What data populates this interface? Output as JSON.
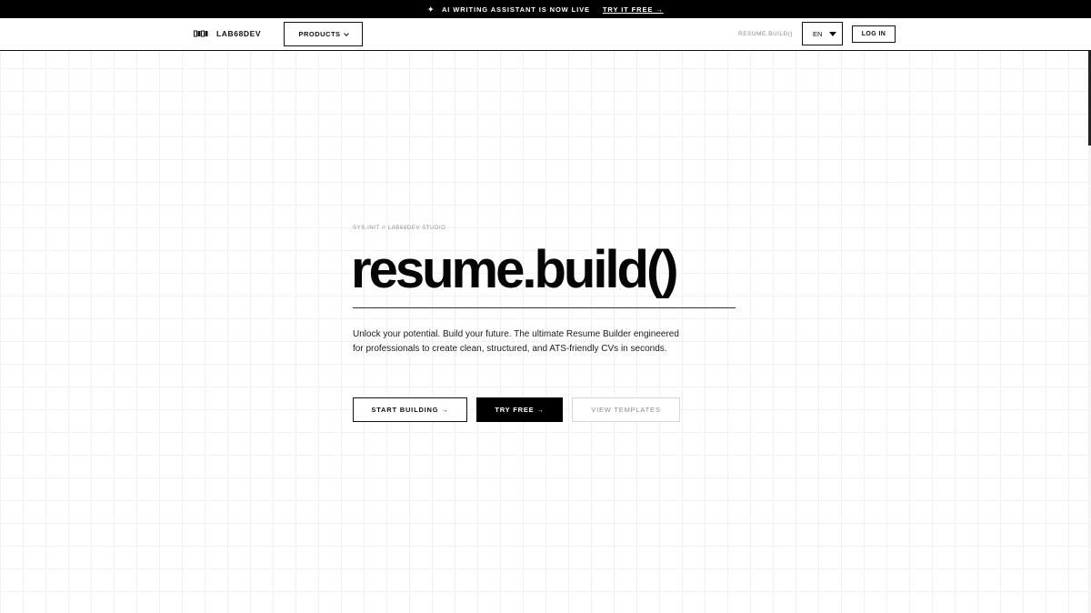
{
  "announcement": {
    "spark": "✦",
    "text": "AI WRITING ASSISTANT IS NOW LIVE",
    "link": "TRY IT FREE →"
  },
  "nav": {
    "brand": "LAB68DEV",
    "products": "PRODUCTS",
    "route": "RESUME.BUILD()",
    "language": "EN",
    "login": "LOG IN"
  },
  "hero": {
    "eyebrow": "SYS.INIT // LAB68DEV STUDIO",
    "title": "resume.build()",
    "description": "Unlock your potential. Build your future. The ultimate Resume Builder engineered for professionals to create clean, structured, and ATS-friendly CVs in seconds.",
    "buttons": {
      "start": "START BUILDING →",
      "try": "TRY FREE →",
      "view": "VIEW TEMPLATES"
    }
  },
  "colors": {
    "background": "#ffffff",
    "text": "#111111",
    "accent": "#000000",
    "muted": "#8c8c8c",
    "grid": "#f1f1f1"
  },
  "icons": {
    "brand_logo": "lab68dev-logo-icon",
    "products_chevron": "chevron-down-icon",
    "language_caret": "caret-down-icon",
    "announcement_spark": "sparkle-icon"
  }
}
